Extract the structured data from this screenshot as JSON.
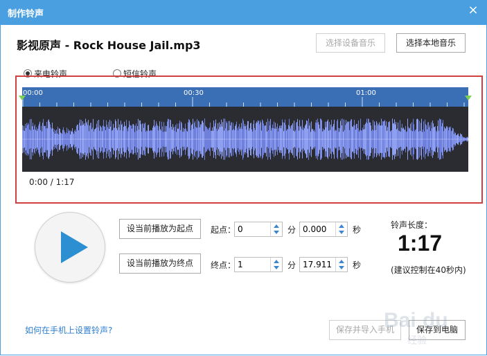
{
  "window": {
    "title": "制作铃声",
    "close_glyph": "×"
  },
  "song": {
    "title": "影视原声 - Rock House Jail.mp3"
  },
  "source_buttons": {
    "device": "选择设备音乐",
    "local": "选择本地音乐"
  },
  "ring_type": {
    "call": "来电铃声",
    "sms": "短信铃声",
    "selected": "call"
  },
  "timeline": {
    "ticks": [
      "00:00",
      "00:30",
      "01:00"
    ]
  },
  "playback": {
    "readout": "0:00 / 1:17"
  },
  "controls": {
    "set_start": "设当前播放为起点",
    "set_end": "设当前播放为终点",
    "start_label": "起点：",
    "end_label": "终点：",
    "min_unit": "分",
    "sec_unit": "秒",
    "start_min": "0",
    "start_sec": "0.000",
    "end_min": "1",
    "end_sec": "17.911"
  },
  "ringtone_length": {
    "label": "铃声长度：",
    "value": "1:17",
    "note": "(建议控制在40秒内)"
  },
  "footer": {
    "help_link": "如何在手机上设置铃声?",
    "save_import": "保存并导入手机",
    "save_pc": "保存到电脑"
  },
  "watermark": {
    "text": "Baidu经验"
  },
  "colors": {
    "titlebar": "#4a9fe1",
    "timeline": "#3a6fb6",
    "wave_bg": "#2a2c31",
    "wave": "#8fa0f0",
    "highlight": "#d14040",
    "play": "#2b8fd1"
  },
  "icons": {
    "play": "play-icon",
    "close": "close-icon"
  }
}
